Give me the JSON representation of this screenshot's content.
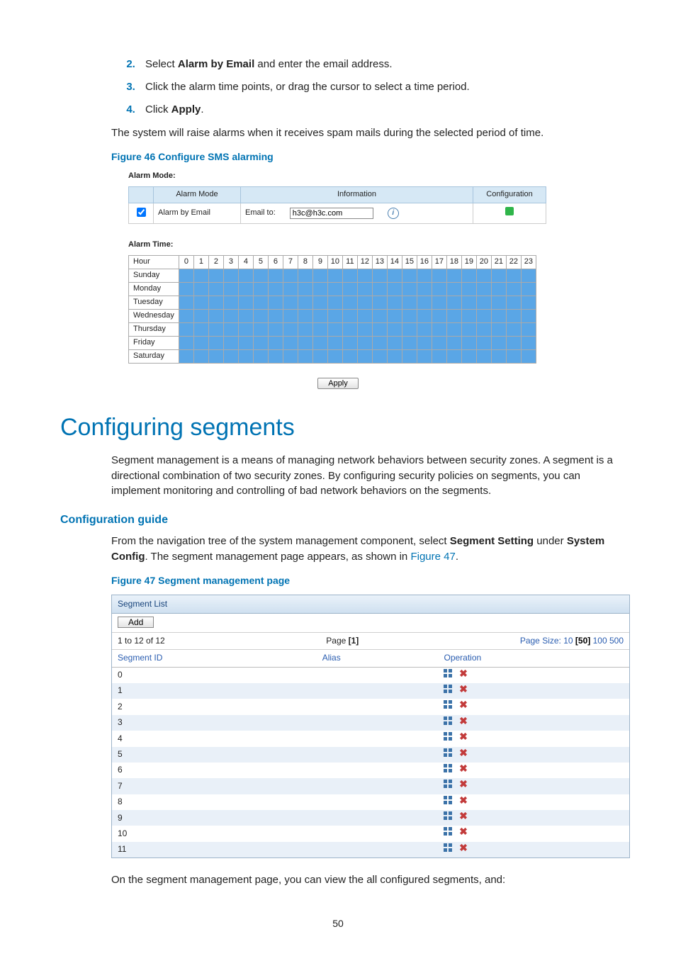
{
  "steps": {
    "s2_pre": "Select ",
    "s2_bold": "Alarm by Email",
    "s2_post": " and enter the email address.",
    "s3": "Click the alarm time points, or drag the cursor to select a time period.",
    "s4_pre": "Click ",
    "s4_bold": "Apply",
    "s4_post": "."
  },
  "para_after_steps": "The system will raise alarms when it receives spam mails during the selected period of time.",
  "figure46_caption": "Figure 46 Configure SMS alarming",
  "alarm_panel": {
    "mode_label": "Alarm Mode:",
    "time_label": "Alarm Time:",
    "columns": {
      "c_blank": "",
      "c_mode": "Alarm Mode",
      "c_info": "Information",
      "c_cfg": "Configuration"
    },
    "row_mode_label": "Alarm by Email",
    "email_label": "Email to:",
    "email_value": "h3c@h3c.com",
    "hour_label": "Hour",
    "hours": [
      "0",
      "1",
      "2",
      "3",
      "4",
      "5",
      "6",
      "7",
      "8",
      "9",
      "10",
      "11",
      "12",
      "13",
      "14",
      "15",
      "16",
      "17",
      "18",
      "19",
      "20",
      "21",
      "22",
      "23"
    ],
    "days": [
      "Sunday",
      "Monday",
      "Tuesday",
      "Wednesday",
      "Thursday",
      "Friday",
      "Saturday"
    ],
    "apply": "Apply"
  },
  "section_title": "Configuring segments",
  "section_intro": "Segment management is a means of managing network behaviors between security zones. A segment is a directional combination of two security zones. By configuring security policies on segments, you can implement monitoring and controlling of bad network behaviors on the segments.",
  "subsection_title": "Configuration guide",
  "config_guide": {
    "p1_a": "From the navigation tree of the system management component, select ",
    "p1_b": "Segment Setting",
    "p1_c": " under ",
    "p1_d": "System Config",
    "p1_e": ". The segment management page appears, as shown in ",
    "p1_link": "Figure 47",
    "p1_f": "."
  },
  "figure47_caption": "Figure 47 Segment management page",
  "segment_panel": {
    "title": "Segment List",
    "add_button": "Add",
    "records_text": "1 to 12 of 12",
    "page_label_pre": "Page ",
    "page_label_num": "[1]",
    "page_size_label": "Page Size: ",
    "page_sizes": [
      "10",
      "50",
      "100",
      "500"
    ],
    "active_size_index": 1,
    "columns": {
      "id": "Segment ID",
      "alias": "Alias",
      "op": "Operation"
    },
    "rows": [
      {
        "id": "0",
        "alias": ""
      },
      {
        "id": "1",
        "alias": ""
      },
      {
        "id": "2",
        "alias": ""
      },
      {
        "id": "3",
        "alias": ""
      },
      {
        "id": "4",
        "alias": ""
      },
      {
        "id": "5",
        "alias": ""
      },
      {
        "id": "6",
        "alias": ""
      },
      {
        "id": "7",
        "alias": ""
      },
      {
        "id": "8",
        "alias": ""
      },
      {
        "id": "9",
        "alias": ""
      },
      {
        "id": "10",
        "alias": ""
      },
      {
        "id": "11",
        "alias": ""
      }
    ]
  },
  "para_after_fig47": "On the segment management page, you can view the all configured segments, and:",
  "page_number": "50"
}
